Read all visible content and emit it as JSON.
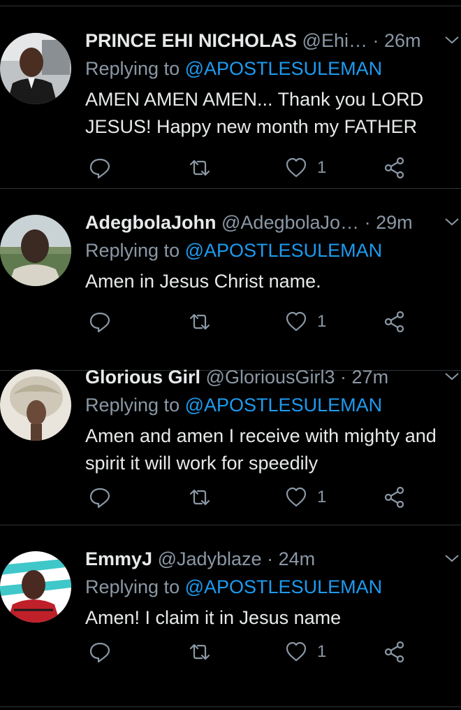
{
  "reply_prefix": "Replying to",
  "tweets": [
    {
      "name": "PRINCE EHI NICHOLAS",
      "handle": "@Ehi…",
      "time": "26m",
      "mention": "@APOSTLESULEMAN",
      "text": "AMEN AMEN AMEN... Thank you LORD JESUS! Happy new month my FATHER",
      "likes": "1"
    },
    {
      "name": "AdegbolaJohn",
      "handle": "@AdegbolaJo…",
      "time": "29m",
      "mention": "@APOSTLESULEMAN",
      "text": "Amen in Jesus Christ name.",
      "likes": "1"
    },
    {
      "name": "Glorious Girl",
      "handle": "@GloriousGirl3",
      "time": "27m",
      "mention": "@APOSTLESULEMAN",
      "text": "Amen and amen I receive with mighty and spirit it will work for speedily",
      "likes": "1"
    },
    {
      "name": "EmmyJ",
      "handle": "@Jadyblaze",
      "time": "24m",
      "mention": "@APOSTLESULEMAN",
      "text": "Amen! I claim it in Jesus name",
      "likes": "1"
    }
  ],
  "colors": {
    "background": "#000000",
    "secondary_text": "#8b98a5",
    "mention": "#1d9bf0",
    "divider": "#2f3336"
  },
  "icons": [
    "reply-icon",
    "retweet-icon",
    "like-icon",
    "share-icon",
    "chevron-down-icon"
  ]
}
